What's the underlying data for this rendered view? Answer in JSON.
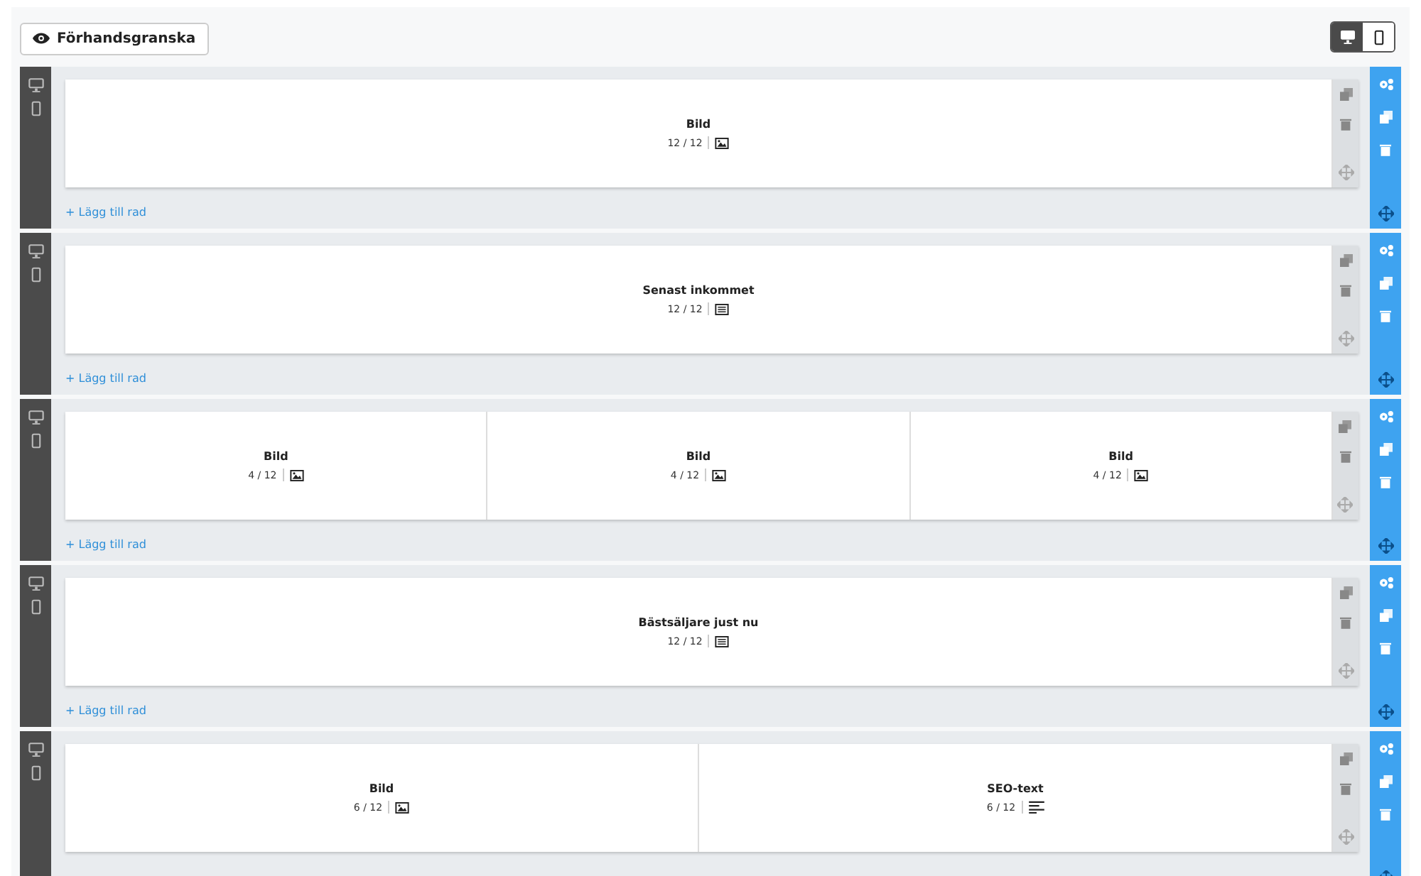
{
  "toolbar": {
    "preview_button": "Förhandsgranska",
    "view_toggle": [
      {
        "kind": "desktop",
        "selected": true
      },
      {
        "kind": "mobile",
        "selected": false
      }
    ]
  },
  "sections": [
    {
      "columns": [
        {
          "title": "Bild",
          "width": "12 / 12",
          "kind": "image"
        }
      ],
      "add_row": "+ Lägg till rad"
    },
    {
      "columns": [
        {
          "title": "Senast inkommet",
          "width": "12 / 12",
          "kind": "list"
        }
      ],
      "add_row": "+ Lägg till rad"
    },
    {
      "columns": [
        {
          "title": "Bild",
          "width": "4 / 12",
          "kind": "image"
        },
        {
          "title": "Bild",
          "width": "4 / 12",
          "kind": "image"
        },
        {
          "title": "Bild",
          "width": "4 / 12",
          "kind": "image"
        }
      ],
      "add_row": "+ Lägg till rad"
    },
    {
      "columns": [
        {
          "title": "Bästsäljare just nu",
          "width": "12 / 12",
          "kind": "list"
        }
      ],
      "add_row": "+ Lägg till rad"
    },
    {
      "columns": [
        {
          "title": "Bild",
          "width": "6 / 12",
          "kind": "image"
        },
        {
          "title": "SEO-text",
          "width": "6 / 12",
          "kind": "text"
        }
      ]
    }
  ]
}
